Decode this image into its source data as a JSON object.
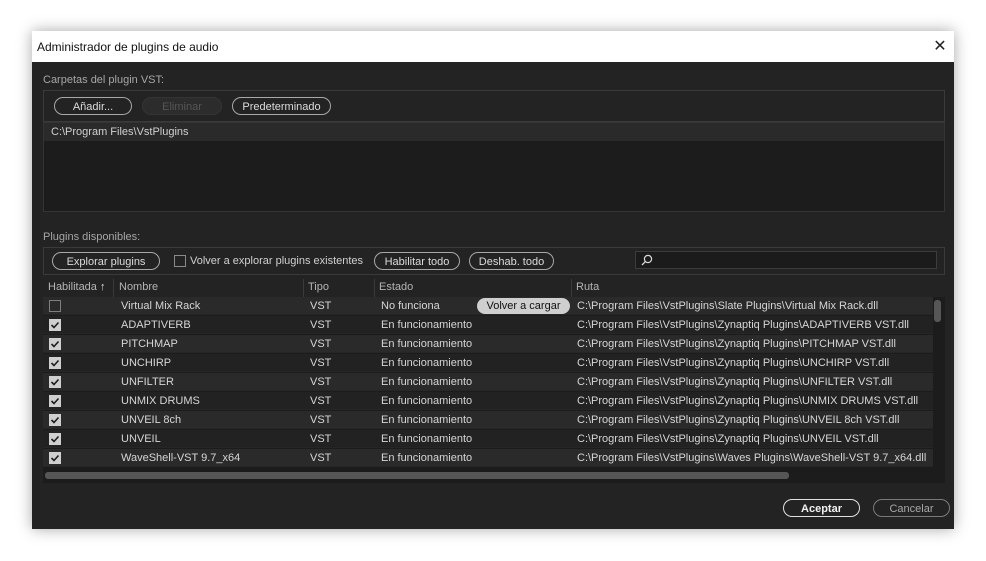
{
  "window": {
    "title": "Administrador de plugins de audio",
    "close_glyph": "✕"
  },
  "vst_folders": {
    "label": "Carpetas del plugin VST:",
    "add_label": "Añadir...",
    "remove_label": "Eliminar",
    "default_label": "Predeterminado",
    "paths": [
      "C:\\Program Files\\VstPlugins"
    ]
  },
  "plugins": {
    "label": "Plugins disponibles:",
    "scan_label": "Explorar plugins",
    "rescan_label": "Volver a explorar plugins existentes",
    "rescan_checked": false,
    "enable_all_label": "Habilitar todo",
    "disable_all_label": "Deshab. todo",
    "search_placeholder": "",
    "search_icon": "search-icon",
    "columns": {
      "enabled": "Habilitada",
      "sort_glyph": "↑",
      "name": "Nombre",
      "type": "Tipo",
      "status": "Estado",
      "path": "Ruta"
    },
    "reload_label": "Volver a cargar",
    "rows": [
      {
        "enabled": false,
        "name": "Virtual Mix Rack",
        "type": "VST",
        "status": "No funciona",
        "path": "C:\\Program Files\\VstPlugins\\Slate Plugins\\Virtual Mix Rack.dll",
        "reload": true
      },
      {
        "enabled": true,
        "name": "ADAPTIVERB",
        "type": "VST",
        "status": "En funcionamiento",
        "path": "C:\\Program Files\\VstPlugins\\Zynaptiq Plugins\\ADAPTIVERB VST.dll"
      },
      {
        "enabled": true,
        "name": "PITCHMAP",
        "type": "VST",
        "status": "En funcionamiento",
        "path": "C:\\Program Files\\VstPlugins\\Zynaptiq Plugins\\PITCHMAP VST.dll"
      },
      {
        "enabled": true,
        "name": "UNCHIRP",
        "type": "VST",
        "status": "En funcionamiento",
        "path": "C:\\Program Files\\VstPlugins\\Zynaptiq Plugins\\UNCHIRP VST.dll"
      },
      {
        "enabled": true,
        "name": "UNFILTER",
        "type": "VST",
        "status": "En funcionamiento",
        "path": "C:\\Program Files\\VstPlugins\\Zynaptiq Plugins\\UNFILTER VST.dll"
      },
      {
        "enabled": true,
        "name": "UNMIX DRUMS",
        "type": "VST",
        "status": "En funcionamiento",
        "path": "C:\\Program Files\\VstPlugins\\Zynaptiq Plugins\\UNMIX DRUMS VST.dll"
      },
      {
        "enabled": true,
        "name": "UNVEIL 8ch",
        "type": "VST",
        "status": "En funcionamiento",
        "path": "C:\\Program Files\\VstPlugins\\Zynaptiq Plugins\\UNVEIL 8ch VST.dll"
      },
      {
        "enabled": true,
        "name": "UNVEIL",
        "type": "VST",
        "status": "En funcionamiento",
        "path": "C:\\Program Files\\VstPlugins\\Zynaptiq Plugins\\UNVEIL VST.dll"
      },
      {
        "enabled": true,
        "name": "WaveShell-VST 9.7_x64",
        "type": "VST",
        "status": "En funcionamiento",
        "path": "C:\\Program Files\\VstPlugins\\Waves Plugins\\WaveShell-VST 9.7_x64.dll"
      }
    ]
  },
  "footer": {
    "ok_label": "Aceptar",
    "cancel_label": "Cancelar"
  }
}
